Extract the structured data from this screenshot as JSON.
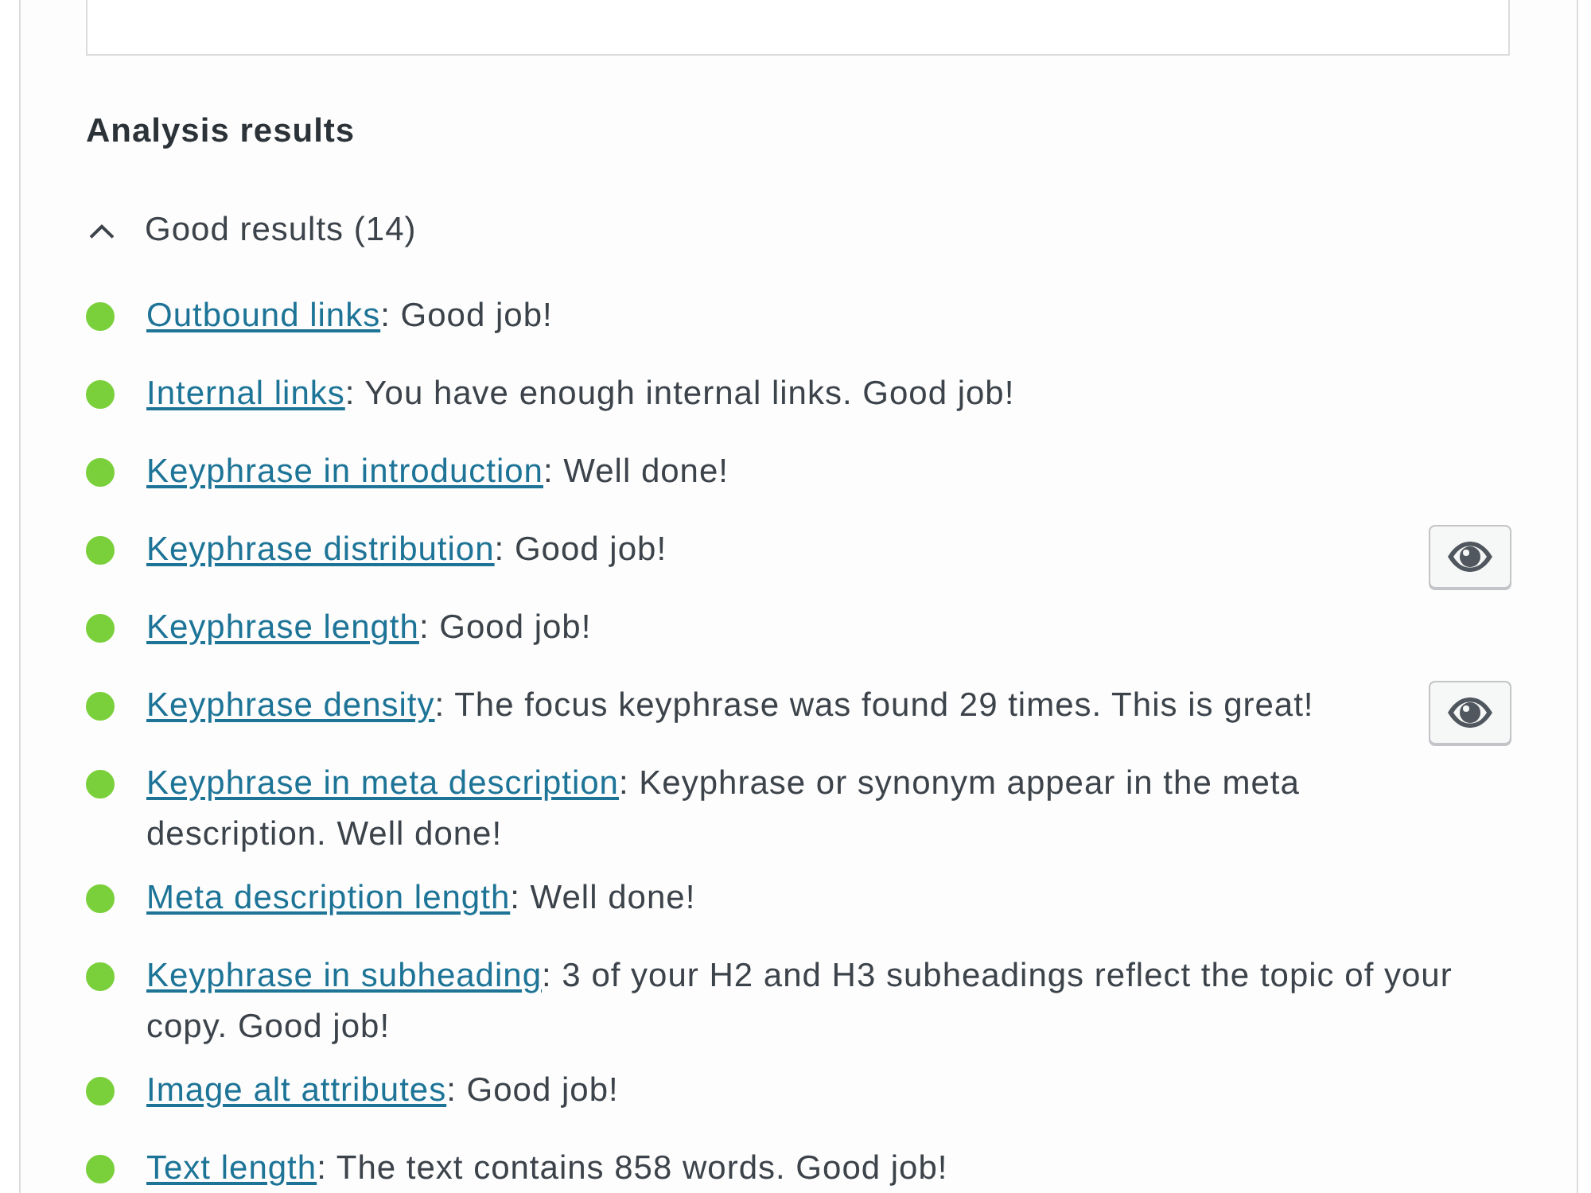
{
  "analysis": {
    "heading": "Analysis results",
    "group": {
      "label": "Good results (14)",
      "expanded": true,
      "items": [
        {
          "title": "Outbound links",
          "text": ": Good job!",
          "marks_button": false
        },
        {
          "title": "Internal links",
          "text": ": You have enough internal links. Good job!",
          "marks_button": false
        },
        {
          "title": "Keyphrase in introduction",
          "text": ": Well done!",
          "marks_button": false
        },
        {
          "title": "Keyphrase distribution",
          "text": ": Good job!",
          "marks_button": true
        },
        {
          "title": "Keyphrase length",
          "text": ": Good job!",
          "marks_button": false
        },
        {
          "title": "Keyphrase density",
          "text": ": The focus keyphrase was found 29 times. This is great!",
          "marks_button": true
        },
        {
          "title": "Keyphrase in meta description",
          "text": ": Keyphrase or synonym appear in the meta description. Well done!",
          "marks_button": false
        },
        {
          "title": "Meta description length",
          "text": ": Well done!",
          "marks_button": false
        },
        {
          "title": "Keyphrase in subheading",
          "text": ": 3 of your H2 and H3 subheadings reflect the topic of your copy. Good job!",
          "marks_button": false
        },
        {
          "title": "Image alt attributes",
          "text": ": Good job!",
          "marks_button": false
        },
        {
          "title": "Text length",
          "text": ": The text contains 858 words. Good job!",
          "marks_button": false
        }
      ]
    }
  }
}
